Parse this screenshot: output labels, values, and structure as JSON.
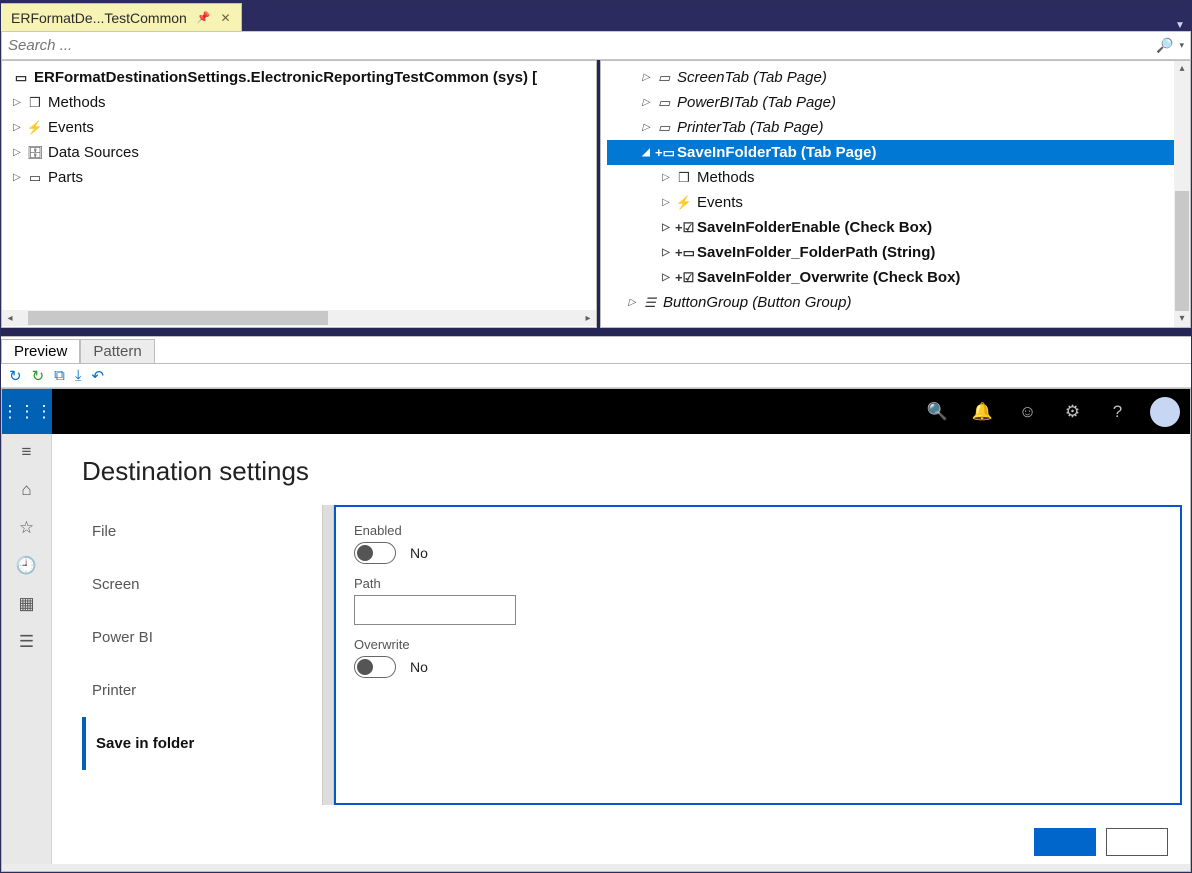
{
  "docTab": {
    "title": "ERFormatDe...TestCommon"
  },
  "search": {
    "placeholder": "Search ..."
  },
  "leftTree": {
    "root": "ERFormatDestinationSettings.ElectronicReportingTestCommon (sys) [",
    "items": [
      "Methods",
      "Events",
      "Data Sources",
      "Parts"
    ]
  },
  "rightTree": {
    "screenTab": "ScreenTab (Tab Page)",
    "powerBiTab": "PowerBITab (Tab Page)",
    "printerTab": "PrinterTab (Tab Page)",
    "saveInFolderTab": "SaveInFolderTab (Tab Page)",
    "methods": "Methods",
    "events": "Events",
    "enable": "SaveInFolderEnable (Check Box)",
    "folderPath": "SaveInFolder_FolderPath (String)",
    "overwrite": "SaveInFolder_Overwrite (Check Box)",
    "buttonGroup": "ButtonGroup (Button Group)"
  },
  "bottomTabs": {
    "preview": "Preview",
    "pattern": "Pattern"
  },
  "preview": {
    "title": "Destination settings",
    "tabs": [
      "File",
      "Screen",
      "Power BI",
      "Printer",
      "Save in folder"
    ],
    "enabled": {
      "label": "Enabled",
      "value": "No"
    },
    "path": {
      "label": "Path",
      "value": ""
    },
    "overwrite": {
      "label": "Overwrite",
      "value": "No"
    }
  }
}
